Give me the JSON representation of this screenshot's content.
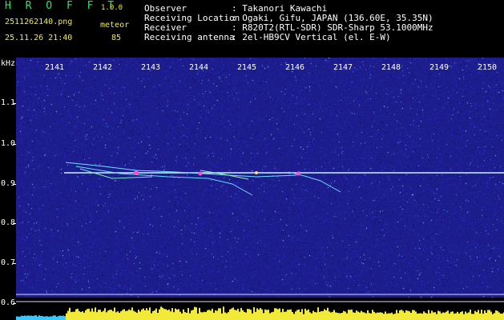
{
  "header": {
    "app_name": "H R O F F T",
    "app_version": "1.0.0",
    "file_name": "2511262140.png",
    "datetime": "25.11.26 21:40",
    "meteor_label": "meteor",
    "meteor_count": "85"
  },
  "metadata": [
    {
      "key": "Observer",
      "value": ": Takanori Kawachi"
    },
    {
      "key": "Receiving Location",
      "value": ": Ogaki, Gifu, JAPAN (136.60E, 35.35N)"
    },
    {
      "key": "Receiver",
      "value": ": R820T2(RTL-SDR) SDR-Sharp 53.1000MHz"
    },
    {
      "key": "Receiving antenna",
      "value": ": 2el-HB9CV Vertical (el. E-W)"
    }
  ],
  "frequency_axis": {
    "unit": "kHz",
    "ticks": [
      {
        "label": "1.1",
        "value": 1.1
      },
      {
        "label": "1.0",
        "value": 1.0
      },
      {
        "label": "0.9",
        "value": 0.9
      },
      {
        "label": "0.8",
        "value": 0.8
      },
      {
        "label": "0.7",
        "value": 0.7
      },
      {
        "label": "0.6",
        "value": 0.6
      }
    ]
  },
  "time_axis": {
    "ticks": [
      "2141",
      "2142",
      "2143",
      "2144",
      "2145",
      "2146",
      "2147",
      "2148",
      "2149",
      "2150"
    ]
  },
  "colors": {
    "background_noise": "#1c1c8c",
    "signal_trace": "#b0f0ff",
    "meteor_echo": "#ff4fd0",
    "level_bar": "#f2ea38",
    "header_text": "#f4ec3a",
    "app_name": "#2ee06a"
  }
}
